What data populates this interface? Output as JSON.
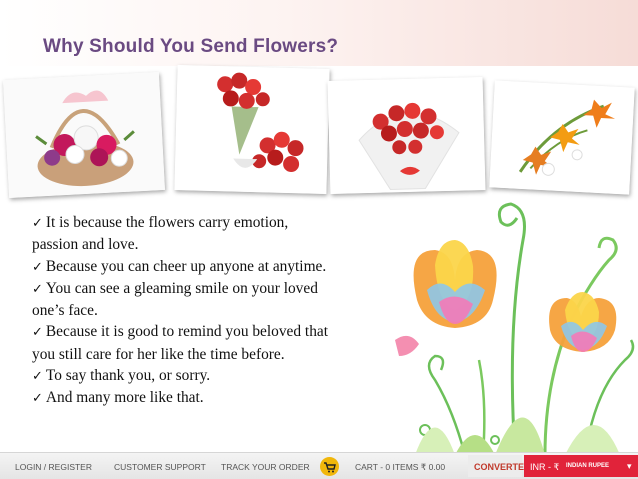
{
  "slide": {
    "title": "Why Should You Send Flowers?",
    "bullets": [
      {
        "lines": [
          "It is because the flowers carry emotion,",
          "passion and love."
        ]
      },
      {
        "lines": [
          "Because you can cheer up anyone at anytime."
        ]
      },
      {
        "lines": [
          "You can see a gleaming smile on your loved",
          "one’s face."
        ]
      },
      {
        "lines": [
          "Because it is good to remind you beloved that",
          "you still care for her like the time before."
        ]
      },
      {
        "lines": [
          "To say thank you, or sorry."
        ]
      },
      {
        "lines": [
          "And many more like that."
        ]
      }
    ],
    "check_glyph": "✓"
  },
  "footer": {
    "login": "LOGIN / REGISTER",
    "support": "CUSTOMER SUPPORT",
    "track": "TRACK YOUR ORDER",
    "cart": "CART - 0 ITEMS ₹ 0.00",
    "converter": "CONVERTER",
    "currency": "INR - ₹",
    "currency_name": "INDIAN RUPEE",
    "dropdown": "▾"
  },
  "icons": {
    "check": "check-icon",
    "cart": "cart-icon",
    "dropdown": "chevron-down-icon"
  },
  "colors": {
    "title": "#6a4a82",
    "cart_icon": "#f1b70b",
    "currency_bg": "#e1233a",
    "converter_text": "#c0392b"
  }
}
